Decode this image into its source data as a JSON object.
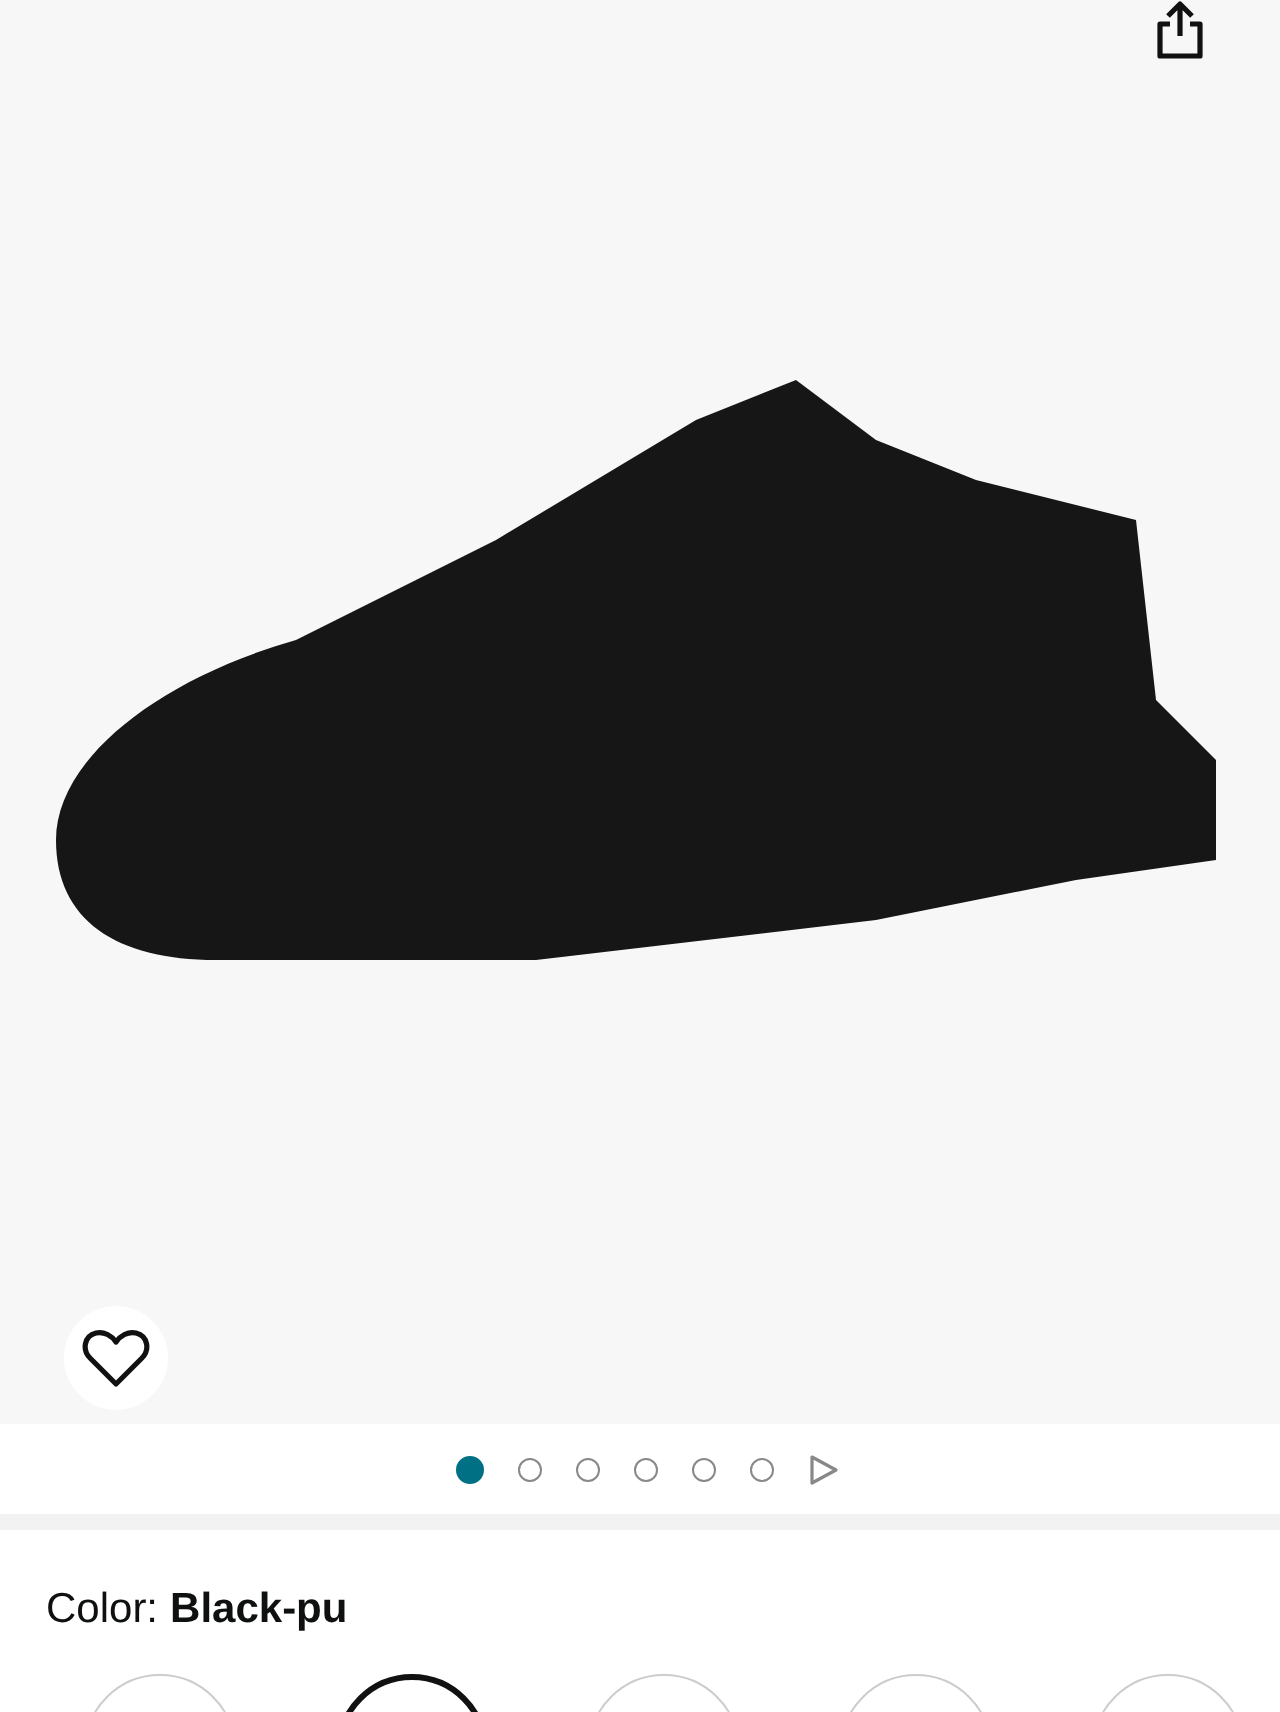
{
  "gallery": {
    "dots": [
      {
        "selected": true
      },
      {
        "selected": false
      },
      {
        "selected": false
      },
      {
        "selected": false
      },
      {
        "selected": false
      },
      {
        "selected": false
      }
    ]
  },
  "color": {
    "label": "Color:",
    "value": "Black-pu"
  },
  "swatches": [
    {
      "selected": false
    },
    {
      "selected": true
    },
    {
      "selected": false
    },
    {
      "selected": false
    },
    {
      "selected": false
    }
  ]
}
